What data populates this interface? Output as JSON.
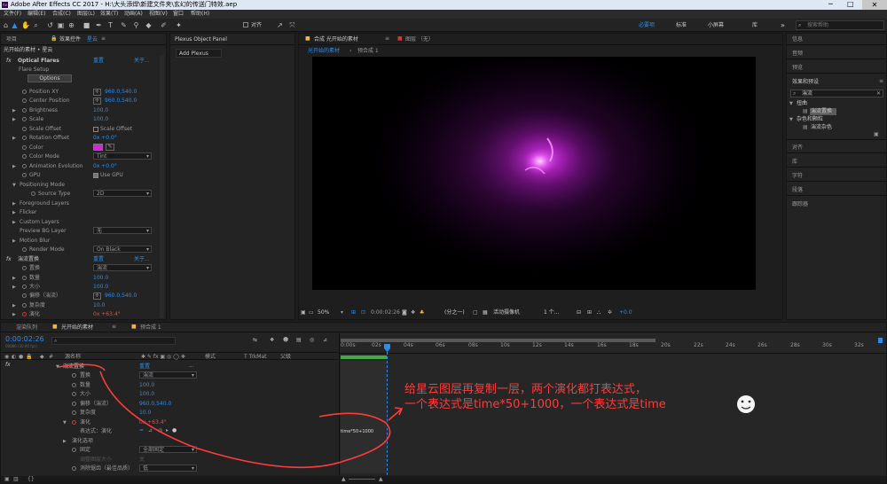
{
  "app": {
    "title": "Adobe After Effects CC 2017 - H:\\大头添焊\\新建文件夹\\玄幻的传送门特效.aep"
  },
  "menu": [
    "文件(F)",
    "编辑(E)",
    "合成(C)",
    "图层(L)",
    "效果(T)",
    "动画(A)",
    "视图(V)",
    "窗口",
    "帮助(H)"
  ],
  "toolbar": {
    "snap_label": "对齐",
    "workspaces": [
      "必要项",
      "标准",
      "小屏幕",
      "库"
    ],
    "search_placeholder": "搜索帮助"
  },
  "effects_panel": {
    "tab_project": "项目",
    "tab_effects": "效果控件",
    "layer_name": "星云",
    "breadcrumb": "光开始的素材 • 星云",
    "fx_name": "Optical Flares",
    "reset": "重置",
    "about": "关于...",
    "flare_setup": "Flare Setup",
    "options_btn": "Options",
    "props": [
      {
        "label": "Position XY",
        "value": "960.0,540.0"
      },
      {
        "label": "Center Position",
        "value": "960.0,540.0"
      },
      {
        "label": "Brightness",
        "value": "100.0"
      },
      {
        "label": "Scale",
        "value": "100.0"
      },
      {
        "label": "Scale Offset",
        "value": "Scale Offset"
      },
      {
        "label": "Rotation Offset",
        "value": "0x +0.0°"
      },
      {
        "label": "Color",
        "value": ""
      },
      {
        "label": "Color Mode",
        "value": "Tint"
      },
      {
        "label": "Animation Evolution",
        "value": "0x +0.0°"
      },
      {
        "label": "GPU",
        "value": "Use GPU"
      },
      {
        "label": "Positioning Mode",
        "value": ""
      },
      {
        "label": "Source Type",
        "value": "2D"
      },
      {
        "label": "Foreground Layers",
        "value": ""
      },
      {
        "label": "Flicker",
        "value": ""
      },
      {
        "label": "Custom Layers",
        "value": ""
      },
      {
        "label": "Preview BG Layer",
        "value": "无"
      },
      {
        "label": "Motion Blur",
        "value": ""
      },
      {
        "label": "Render Mode",
        "value": "On Black"
      }
    ],
    "fx2_name": "湍流置换",
    "props2": [
      {
        "label": "置换",
        "value": "湍流"
      },
      {
        "label": "数量",
        "value": "100.0"
      },
      {
        "label": "大小",
        "value": "100.0"
      },
      {
        "label": "偏移（湍流）",
        "value": "960.0,540.0"
      },
      {
        "label": "复杂度",
        "value": "10.0"
      },
      {
        "label": "演化",
        "value": "0x +63.4°"
      }
    ]
  },
  "plexus_panel": {
    "tab": "Plexus Object Panel",
    "add_label": "Add Plexus"
  },
  "comp_panel": {
    "tab_comp": "合成 光开始的素材",
    "tab_layer": "图层 （无）",
    "subtabs": [
      "光开始的素材",
      "预合成 1"
    ],
    "zoom": "50%",
    "timecode": "0:00:02:26",
    "quality": "(分之一)",
    "camera": "活动摄像机",
    "views": "1 个...",
    "exposure": "+0.0"
  },
  "right_panels": {
    "items": [
      "信息",
      "音频",
      "预览",
      "效果和预设"
    ],
    "search_value": "湍流",
    "tree": [
      {
        "label": "扭曲",
        "child": "湍流置换"
      },
      {
        "label": "杂色和颗粒",
        "child": "湍流杂色"
      }
    ],
    "more": [
      "对齐",
      "库",
      "字符",
      "段落",
      "跟踪器"
    ]
  },
  "timeline": {
    "tabs": [
      "渲染队列",
      "光开始的素材",
      "预合成 1"
    ],
    "timecode": "0:00:02:26",
    "timecode_sub": "00086 (30.00 fps)",
    "columns": [
      "源名称",
      "模式",
      "T TrkMat",
      "父级"
    ],
    "rows": [
      {
        "label": "湍流置换",
        "value": "重置",
        "indent": 0
      },
      {
        "label": "置换",
        "value": "湍流",
        "indent": 1
      },
      {
        "label": "数量",
        "value": "100.0",
        "indent": 1
      },
      {
        "label": "大小",
        "value": "100.0",
        "indent": 1
      },
      {
        "label": "偏移（湍流）",
        "value": "960.0,540.0",
        "indent": 1
      },
      {
        "label": "复杂度",
        "value": "10.0",
        "indent": 1
      },
      {
        "label": "演化",
        "value": "0x +63.4°",
        "indent": 1
      },
      {
        "label": "表达式：演化",
        "value": "",
        "indent": 2
      },
      {
        "label": "演化选项",
        "value": "",
        "indent": 0
      },
      {
        "label": "固定",
        "value": "全部固定",
        "indent": 1
      },
      {
        "label": "调整图层大小",
        "value": "关",
        "indent": 1
      },
      {
        "label": "消除锯齿（最佳品质）",
        "value": "低",
        "indent": 1
      }
    ],
    "ruler": [
      "0:00s",
      "02s",
      "04s",
      "06s",
      "08s",
      "10s",
      "12s",
      "14s",
      "16s",
      "18s",
      "20s",
      "22s",
      "24s",
      "26s",
      "28s",
      "30s",
      "32s"
    ],
    "expression": "time*50+1000"
  },
  "annotation": {
    "line1": "给星云图层再复制一层，两个演化都打表达式，",
    "line2": "一个表达式是time*50+1000，一个表达式是time",
    "color": "#ff3b3b"
  },
  "colors": {
    "accent": "#2d8ceb",
    "flare": "#d02ad8"
  }
}
